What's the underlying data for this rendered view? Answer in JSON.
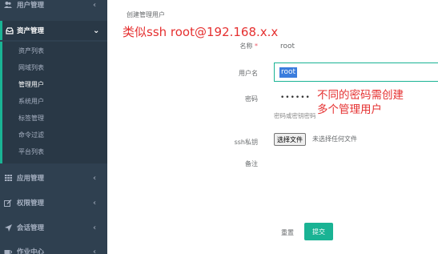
{
  "sidebar": {
    "groups": [
      {
        "label": "用户管理",
        "icon": "users-icon",
        "chevron": "‹"
      },
      {
        "label": "资产管理",
        "icon": "inbox-icon",
        "chevron": "⌄"
      },
      {
        "label": "应用管理",
        "icon": "grid-icon",
        "chevron": "‹"
      },
      {
        "label": "权限管理",
        "icon": "edit-icon",
        "chevron": "‹"
      },
      {
        "label": "会话管理",
        "icon": "rocket-icon",
        "chevron": "‹"
      },
      {
        "label": "作业中心",
        "icon": "coffee-icon",
        "chevron": "‹"
      }
    ],
    "asset_subitems": [
      "资产列表",
      "网域列表",
      "管理用户",
      "系统用户",
      "标签管理",
      "命令过滤",
      "平台列表"
    ]
  },
  "form": {
    "panel_title": "创建管理用户",
    "name_label": "名称",
    "required_mark": "*",
    "name_value": "root",
    "username_label": "用户名",
    "username_value": "root",
    "password_label": "密码",
    "password_value": "••••••",
    "password_help": "密码或密钥密码",
    "ssh_key_label": "ssh私钥",
    "file_button": "选择文件",
    "file_status": "未选择任何文件",
    "comment_label": "备注",
    "reset_button": "重置",
    "submit_button": "提交"
  },
  "annotations": {
    "line1": "类似ssh  root@192.168.x.x",
    "line2a": "不同的密码需创建",
    "line2b": "多个管理用户"
  },
  "colors": {
    "sidebar_bg": "#2f4050",
    "accent": "#1ab394",
    "annotation": "#e53030"
  }
}
